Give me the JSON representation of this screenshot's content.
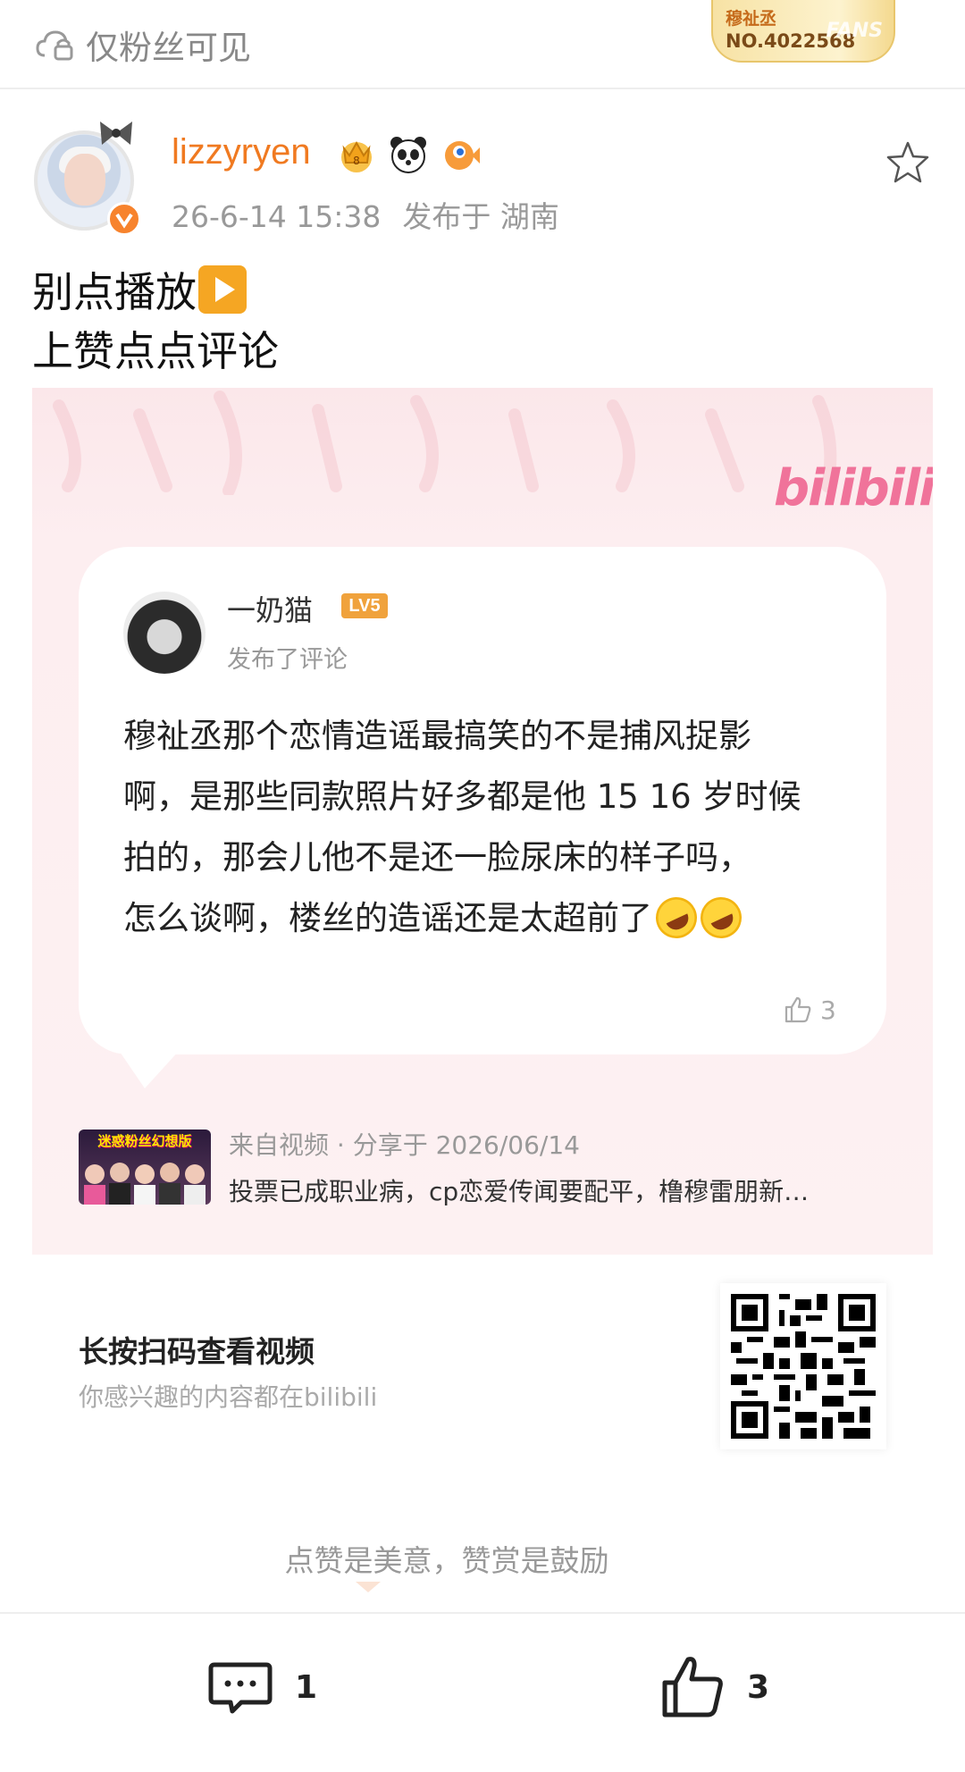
{
  "topbar": {
    "visibility_label": "仅粉丝可见",
    "fans_badge": {
      "name": "穆祉丞",
      "number": "NO.4022568",
      "watermark": "FANS"
    }
  },
  "post": {
    "username": "lizzyryen",
    "timestamp": "26-6-14 15:38",
    "location": "发布于 湖南",
    "text_lines": [
      "别点播放",
      "上赞点点评论"
    ]
  },
  "share_card": {
    "platform": "bilibili",
    "comment": {
      "author": "一奶猫",
      "level": "LV5",
      "subtitle": "发布了评论",
      "lines": [
        "穆祉丞那个恋情造谣最搞笑的不是捕风捉影",
        "啊，是那些同款照片好多都是他 15 16 岁时候",
        "拍的，那会儿他不是还一脸尿床的样子吗，",
        "怎么谈啊，楼丝的造谣还是太超前了"
      ],
      "likes": "3"
    },
    "video": {
      "thumb_title": "迷惑粉丝幻想版",
      "source": "来自视频 · 分享于 2026/06/14",
      "description": "投票已成职业病，cp恋爱传闻要配平，橹穆雷朋新…"
    }
  },
  "qr": {
    "title": "长按扫码查看视频",
    "subtitle": "你感兴趣的内容都在bilibili"
  },
  "encourage_text": "点赞是美意，赞赏是鼓励",
  "bottombar": {
    "comment_count": "1",
    "like_count": "3"
  },
  "colors": {
    "username": "#f07a21",
    "bilibili_pink": "#f0739a",
    "verified": "#f7832d",
    "card_bg": "#fdeef0"
  }
}
